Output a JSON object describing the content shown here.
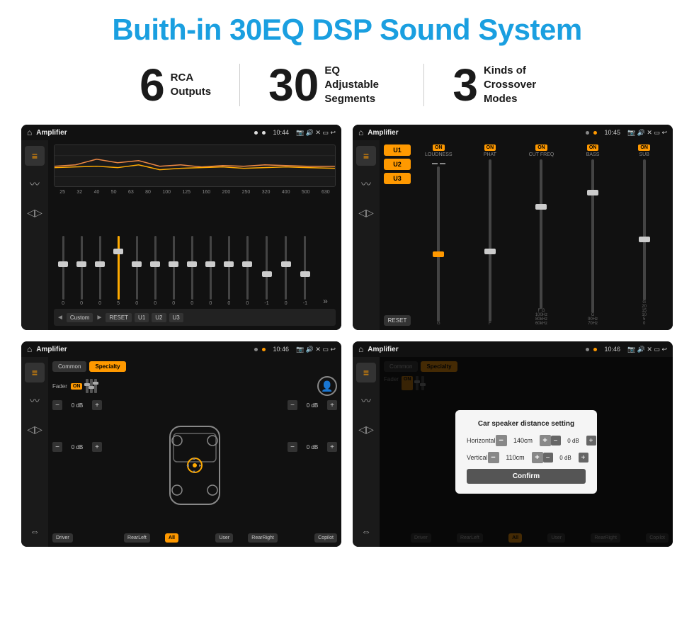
{
  "title": "Buith-in 30EQ DSP Sound System",
  "stats": [
    {
      "number": "6",
      "text": "RCA\nOutputs"
    },
    {
      "number": "30",
      "text": "EQ Adjustable\nSegments"
    },
    {
      "number": "3",
      "text": "Kinds of\nCrossover Modes"
    }
  ],
  "screens": [
    {
      "id": "screen1",
      "status": {
        "app": "Amplifier",
        "time": "10:44"
      },
      "eq_labels": [
        "25",
        "32",
        "40",
        "50",
        "63",
        "80",
        "100",
        "125",
        "160",
        "200",
        "250",
        "320",
        "400",
        "500",
        "630"
      ],
      "eq_values": [
        "0",
        "0",
        "0",
        "5",
        "0",
        "0",
        "0",
        "0",
        "0",
        "0",
        "0",
        "-1",
        "0",
        "-1"
      ],
      "bottom_buttons": [
        "Custom",
        "RESET",
        "U1",
        "U2",
        "U3"
      ]
    },
    {
      "id": "screen2",
      "status": {
        "app": "Amplifier",
        "time": "10:45"
      },
      "presets": [
        "U1",
        "U2",
        "U3"
      ],
      "controls": [
        "LOUDNESS",
        "PHAT",
        "CUT FREQ",
        "BASS",
        "SUB"
      ],
      "on_labels": [
        "ON",
        "ON",
        "ON",
        "ON",
        "ON"
      ]
    },
    {
      "id": "screen3",
      "status": {
        "app": "Amplifier",
        "time": "10:46"
      },
      "tabs": [
        "Common",
        "Specialty"
      ],
      "fader_label": "Fader",
      "on_label": "ON",
      "vol_values": [
        "0 dB",
        "0 dB",
        "0 dB",
        "0 dB"
      ],
      "bottom_buttons": [
        "Driver",
        "",
        "RearLeft",
        "All",
        "",
        "User",
        "RearRight",
        "Copilot"
      ]
    },
    {
      "id": "screen4",
      "status": {
        "app": "Amplifier",
        "time": "10:46"
      },
      "tabs": [
        "Common",
        "Specialty"
      ],
      "modal": {
        "title": "Car speaker distance setting",
        "horizontal_label": "Horizontal",
        "horizontal_value": "140cm",
        "vertical_label": "Vertical",
        "vertical_value": "110cm",
        "confirm_label": "Confirm",
        "right_val1": "0 dB",
        "right_val2": "0 dB"
      }
    }
  ]
}
